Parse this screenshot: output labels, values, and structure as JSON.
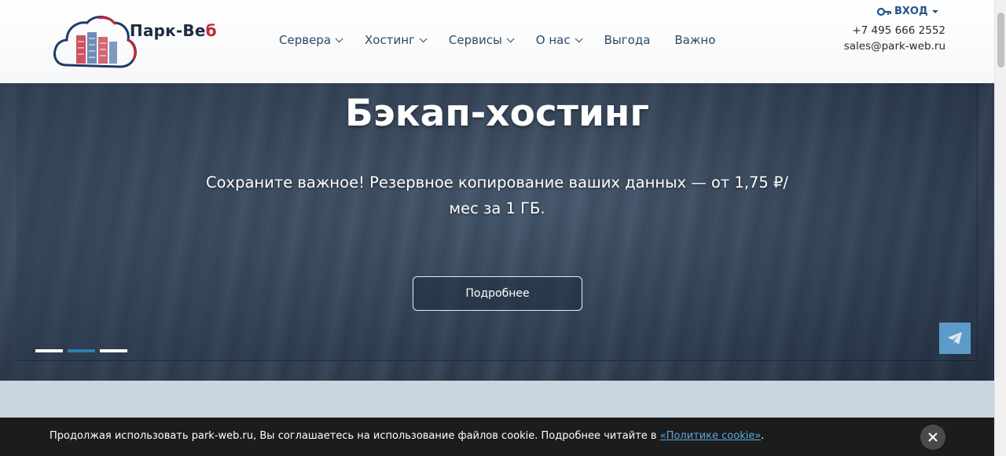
{
  "header": {
    "logo_text_main": "Парк-Ве",
    "logo_text_accent": "б",
    "login_label": "ВХОД",
    "phone": "+7 495 666 2552",
    "email": "sales@park-web.ru"
  },
  "nav": {
    "items": [
      {
        "label": "Сервера",
        "dropdown": true
      },
      {
        "label": "Хостинг",
        "dropdown": true
      },
      {
        "label": "Сервисы",
        "dropdown": true
      },
      {
        "label": "О нас",
        "dropdown": true
      },
      {
        "label": "Выгода",
        "dropdown": false
      },
      {
        "label": "Важно",
        "dropdown": false
      }
    ]
  },
  "hero": {
    "title": "Бэкап-хостинг",
    "subtitle": "Сохраните важное! Резервное копирование ваших данных — от 1,75 ₽/мес за 1 ГБ.",
    "button_label": "Подробнее",
    "slides_count": 3,
    "active_slide": 2
  },
  "cookie": {
    "text_before": "Продолжая использовать park-web.ru, Вы соглашаетесь на использование файлов cookie. Подробнее читайте в ",
    "link_label": "«Политике cookie»",
    "text_after": "."
  },
  "colors": {
    "brand_dark": "#1f2a44",
    "brand_accent": "#c0283a",
    "nav_text": "#2c4a66",
    "dot_active": "#2f7fb0",
    "telegram_btn": "#5d9cc8",
    "cookie_bg": "#1c1c1c"
  },
  "icons": {
    "login": "key-icon",
    "chevron": "chevron-down-icon",
    "telegram": "telegram-icon",
    "close": "close-icon"
  }
}
